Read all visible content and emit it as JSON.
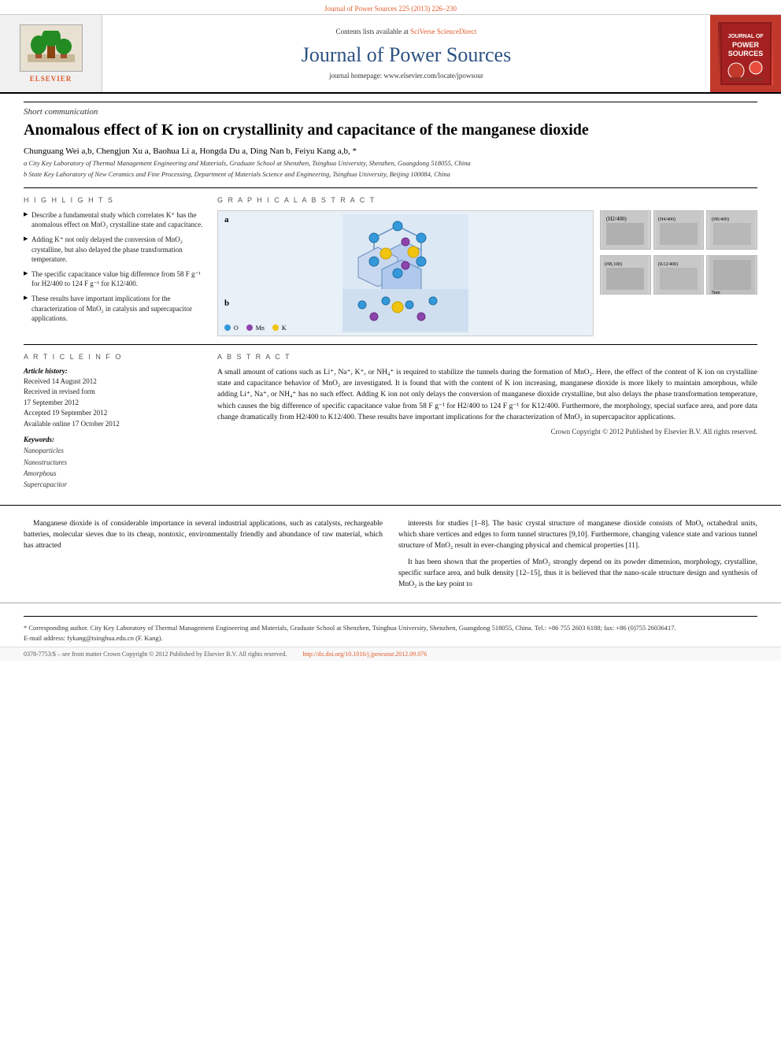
{
  "journal": {
    "top_bar": "Journal of Power Sources 225 (2013) 226–230",
    "sciverse_text": "Contents lists available at",
    "sciverse_link": "SciVerse ScienceDirect",
    "title": "Journal of Power Sources",
    "homepage": "journal homepage: www.elsevier.com/locate/jpowsour",
    "elsevier_name": "ELSEVIER",
    "cover_label": "JOURNAL OF\nPOWER\nSOURCES"
  },
  "article": {
    "type": "Short communication",
    "title": "Anomalous effect of K ion on crystallinity and capacitance of the manganese dioxide",
    "authors": "Chunguang Wei a,b, Chengjun Xu a, Baohua Li a, Hongda Du a, Ding Nan b, Feiyu Kang a,b, *",
    "affiliation_a": "a City Key Laboratory of Thermal Management Engineering and Materials, Graduate School at Shenzhen, Tsinghua University, Shenzhen, Guangdong 518055, China",
    "affiliation_b": "b State Key Laboratory of New Ceramics and Fine Processing, Department of Materials Science and Engineering, Tsinghua University, Beijing 100084, China"
  },
  "highlights": {
    "label": "H I G H L I G H T S",
    "items": [
      "Describe a fundamental study which correlates K⁺ has the anomalous effect on MnO₂ crystalline state and capacitance.",
      "Adding K⁺ not only delayed the conversion of MnO₂ crystalline, but also delayed the phase transformation temperature.",
      "The specific capacitance value big difference from 58 F g⁻¹ for H2/400 to 124 F g⁻¹ for K12/400.",
      "These results have important implications for the characterization of MnO₂ in catalysis and supercapacitor applications."
    ]
  },
  "graphical_abstract": {
    "label": "G R A P H I C A L   A B S T R A C T",
    "label_a": "a",
    "label_b": "b",
    "legend": [
      {
        "color": "#3498db",
        "label": "O"
      },
      {
        "color": "#8e44ad",
        "label": "Mn"
      },
      {
        "color": "#f1c40f",
        "label": "K"
      }
    ]
  },
  "article_info": {
    "label": "A R T I C L E   I N F O",
    "history_label": "Article history:",
    "received": "Received 14 August 2012",
    "revised": "Received in revised form 17 September 2012",
    "accepted": "Accepted 19 September 2012",
    "available": "Available online 17 October 2012",
    "keywords_label": "Keywords:",
    "keywords": [
      "Nanoparticles",
      "Nanostructures",
      "Amorphous",
      "Supercapacitor"
    ]
  },
  "abstract": {
    "label": "A B S T R A C T",
    "text": "A small amount of cations such as Li⁺, Na⁺, K⁺, or NH₄⁺ is required to stabilize the tunnels during the formation of MnO₂. Here, the effect of the content of K ion on crystalline state and capacitance behavior of MnO₂ are investigated. It is found that with the content of K ion increasing, manganese dioxide is more likely to maintain amorphous, while adding Li⁺, Na⁺, or NH₄⁺ has no such effect. Adding K ion not only delays the conversion of manganese dioxide crystalline, but also delays the phase transformation temperature, which causes the big difference of specific capacitance value from 58 F g⁻¹ for H2/400 to 124 F g⁻¹ for K12/400. Furthermore, the morphology, special surface area, and pore data change dramatically from H2/400 to K12/400. These results have important implications for the characterization of MnO₂ in supercapacitor applications.",
    "copyright": "Crown Copyright © 2012 Published by Elsevier B.V. All rights reserved."
  },
  "body": {
    "col1_para1": "Manganese dioxide is of considerable importance in several industrial applications, such as catalysts, rechargeable batteries, molecular sieves due to its cheap, nontoxic, environmentally friendly and abundance of raw material, which has attracted",
    "col2_para1": "interests for studies [1–8]. The basic crystal structure of manganese dioxide consists of MnO₆ octahedral units, which share vertices and edges to form tunnel structures [9,10]. Furthermore, changing valence state and various tunnel structure of MnO₂ result in ever-changing physical and chemical properties [11].",
    "col2_para2": "It has been shown that the properties of MnO₂ strongly depend on its powder dimension, morphology, crystalline, specific surface area, and bulk density [12–15], thus it is believed that the nano-scale structure design and synthesis of MnO₂ is the key point to"
  },
  "footnotes": {
    "corresponding": "* Corresponding author. City Key Laboratory of Thermal Management Engineering and Materials, Graduate School at Shenzhen, Tsinghua University, Shenzhen, Guangdong 518055, China. Tel.: +86 755 2603 6188; fax: +86 (0)755 26036417.",
    "email": "E-mail address: fykang@tsinghua.edu.cn (F. Kang)."
  },
  "footer": {
    "issn": "0378-7753/$ – see front matter Crown Copyright © 2012 Published by Elsevier B.V. All rights reserved.",
    "doi_label": "http://dx.doi.org/10.1016/j.jpowsour.2012.09.076"
  }
}
